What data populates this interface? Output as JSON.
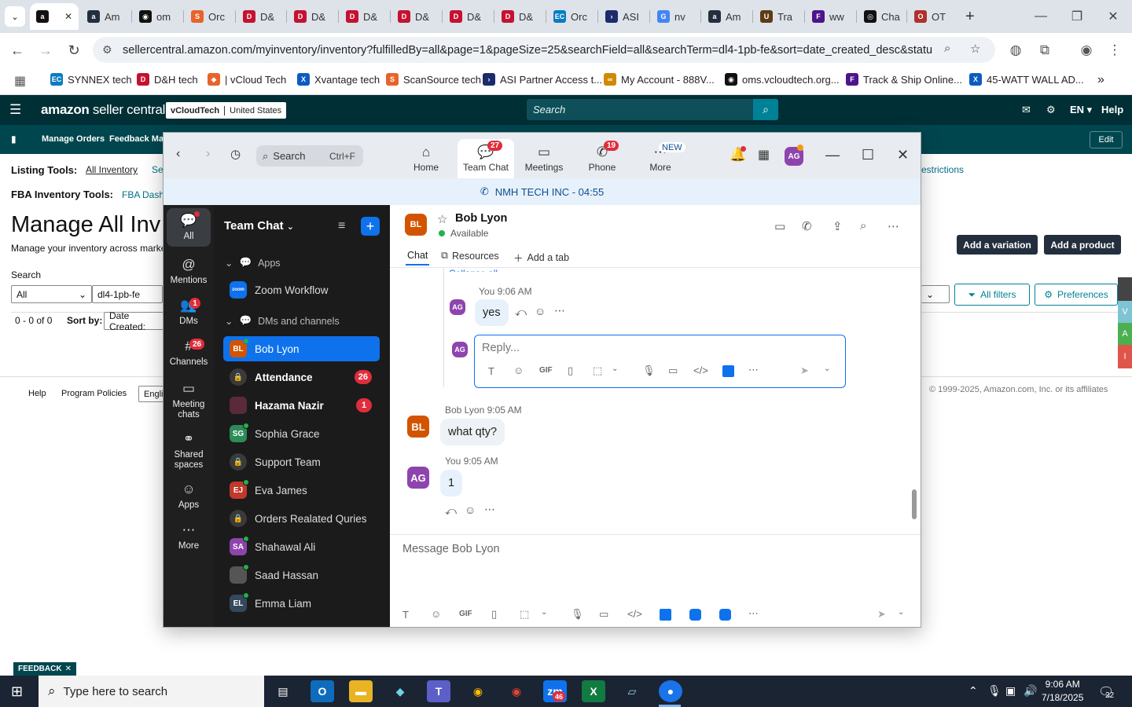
{
  "browser": {
    "tabs": [
      {
        "label": "",
        "fav": "a",
        "color": "#111111",
        "active": true
      },
      {
        "label": "Am",
        "fav": "a",
        "color": "#232f3e"
      },
      {
        "label": "om",
        "fav": "◉",
        "color": "#111111"
      },
      {
        "label": "Orc",
        "fav": "S",
        "color": "#e8632b"
      },
      {
        "label": "D&",
        "fav": "D",
        "color": "#c41230"
      },
      {
        "label": "D&",
        "fav": "D",
        "color": "#c41230"
      },
      {
        "label": "D&",
        "fav": "D",
        "color": "#c41230"
      },
      {
        "label": "D&",
        "fav": "D",
        "color": "#c41230"
      },
      {
        "label": "D&",
        "fav": "D",
        "color": "#c41230"
      },
      {
        "label": "D&",
        "fav": "D",
        "color": "#c41230"
      },
      {
        "label": "Orc",
        "fav": "EC",
        "color": "#0a7cc2"
      },
      {
        "label": "ASI",
        "fav": "›",
        "color": "#1b2b6b"
      },
      {
        "label": "nv",
        "fav": "G",
        "color": "#4285f4"
      },
      {
        "label": "Am",
        "fav": "a",
        "color": "#232f3e"
      },
      {
        "label": "Tra",
        "fav": "U",
        "color": "#5e3b16"
      },
      {
        "label": "ww",
        "fav": "F",
        "color": "#4d148c"
      },
      {
        "label": "Cha",
        "fav": "◎",
        "color": "#111111"
      },
      {
        "label": "OT",
        "fav": "O",
        "color": "#b03030"
      }
    ],
    "new_tab": "+",
    "url": "sellercentral.amazon.com/myinventory/inventory?fulfilledBy=all&page=1&pageSize=25&searchField=all&searchTerm=dl4-1pb-fe&sort=date_created_desc&status=...",
    "bookmarks": [
      {
        "label": "SYNNEX tech",
        "fav": "EC",
        "color": "#0a7cc2"
      },
      {
        "label": "D&H tech",
        "fav": "D",
        "color": "#c41230"
      },
      {
        "label": "| vCloud Tech",
        "fav": "◆",
        "color": "#e8632b"
      },
      {
        "label": "Xvantage tech",
        "fav": "X",
        "color": "#0a5cc2"
      },
      {
        "label": "ScanSource tech",
        "fav": "S",
        "color": "#e8632b"
      },
      {
        "label": "ASI Partner Access t...",
        "fav": "›",
        "color": "#1b2b6b"
      },
      {
        "label": "My Account - 888V...",
        "fav": "∞",
        "color": "#d08a00"
      },
      {
        "label": "oms.vcloudtech.org...",
        "fav": "◉",
        "color": "#111111"
      },
      {
        "label": "Track & Ship Online...",
        "fav": "F",
        "color": "#4d148c"
      },
      {
        "label": "45-WATT WALL AD...",
        "fav": "X",
        "color": "#0a5cc2"
      }
    ],
    "more_bookmarks": "»"
  },
  "amazon": {
    "logo_main": "amazon",
    "logo_sub": " seller central",
    "store_name": "vCloudTech",
    "store_country": "United States",
    "search_placeholder": "Search",
    "lang": "EN",
    "help": "Help",
    "nav": [
      "Manage Orders",
      "Feedback Man"
    ],
    "edit": "Edit",
    "listing_tools_label": "Listing Tools:",
    "listing_tools_link": "All Inventory",
    "listing_tools_more": "Se",
    "restrictions": "estrictions",
    "fba_tools_label": "FBA Inventory Tools:",
    "fba_tools_link": "FBA Dashb",
    "page_title": "Manage All Inv",
    "page_subtitle": "Manage your inventory across market",
    "add_variation": "Add a variation",
    "add_product": "Add a product",
    "search_label": "Search",
    "search_scope": "All",
    "search_value": "dl4-1pb-fe",
    "all_filters": "All filters",
    "preferences": "Preferences",
    "results": "0 - 0 of 0",
    "sort_label": "Sort by:",
    "sort_value": "Date Created:",
    "footer_help": "Help",
    "footer_policies": "Program Policies",
    "footer_lang": "Engli",
    "copyright": "© 1999-2025, Amazon.com, Inc. or its affiliates",
    "feedback": "FEEDBACK",
    "side_tabs": [
      "V",
      "A",
      "I"
    ]
  },
  "zoom": {
    "search_label": "Search",
    "search_shortcut": "Ctrl+F",
    "tabs": [
      {
        "label": "Home",
        "icon": "⌂",
        "badge": ""
      },
      {
        "label": "Team Chat",
        "icon": "💬",
        "badge": "27"
      },
      {
        "label": "Meetings",
        "icon": "▭",
        "badge": ""
      },
      {
        "label": "Phone",
        "icon": "✆",
        "badge": "19"
      },
      {
        "label": "More",
        "icon": "⋯",
        "badge": "NEW"
      }
    ],
    "avatar_initials": "AG",
    "banner": "NMH TECH INC - 04:55",
    "rail": [
      {
        "label": "All",
        "icon": "💬",
        "badge": ""
      },
      {
        "label": "Mentions",
        "icon": "@",
        "badge": ""
      },
      {
        "label": "DMs",
        "icon": "👥",
        "badge": "1"
      },
      {
        "label": "Channels",
        "icon": "#",
        "badge": "26"
      },
      {
        "label": "Meeting chats",
        "icon": "▭",
        "badge": ""
      },
      {
        "label": "Shared spaces",
        "icon": "⚭",
        "badge": ""
      },
      {
        "label": "Apps",
        "icon": "☺",
        "badge": ""
      },
      {
        "label": "More",
        "icon": "⋯",
        "badge": ""
      }
    ],
    "list_title": "Team Chat",
    "section_apps": "Apps",
    "app_item": "Zoom Workflow",
    "app_item_icon": "zoom",
    "section_dms": "DMs and channels",
    "items": [
      {
        "name": "Bob Lyon",
        "initials": "BL",
        "color": "#d35400",
        "count": "",
        "selected": true,
        "bold": false,
        "status": true
      },
      {
        "name": "Attendance",
        "initials": "🔒",
        "color": "#3a3a3a",
        "count": "26",
        "selected": false,
        "bold": true,
        "status": false
      },
      {
        "name": "Hazama Nazir",
        "initials": "",
        "color": "#5a2a3a",
        "count": "1",
        "selected": false,
        "bold": true,
        "status": false
      },
      {
        "name": "Sophia Grace",
        "initials": "SG",
        "color": "#2e8b57",
        "count": "",
        "selected": false,
        "bold": false,
        "status": true
      },
      {
        "name": "Support Team",
        "initials": "🔒",
        "color": "#3a3a3a",
        "count": "",
        "selected": false,
        "bold": false,
        "status": false
      },
      {
        "name": "Eva James",
        "initials": "EJ",
        "color": "#c0392b",
        "count": "",
        "selected": false,
        "bold": false,
        "status": true
      },
      {
        "name": "Orders Realated Quries",
        "initials": "🔒",
        "color": "#3a3a3a",
        "count": "",
        "selected": false,
        "bold": false,
        "status": false
      },
      {
        "name": "Shahawal Ali",
        "initials": "SA",
        "color": "#8e44ad",
        "count": "",
        "selected": false,
        "bold": false,
        "status": true
      },
      {
        "name": "Saad Hassan",
        "initials": "",
        "color": "#555555",
        "count": "",
        "selected": false,
        "bold": false,
        "status": true
      },
      {
        "name": "Emma Liam",
        "initials": "EL",
        "color": "#34495e",
        "count": "",
        "selected": false,
        "bold": false,
        "status": true
      }
    ],
    "chat": {
      "contact_name": "Bob Lyon",
      "contact_initials": "BL",
      "contact_status": "Available",
      "tab_chat": "Chat",
      "tab_resources": "Resources",
      "tab_add": "Add a tab",
      "collapse": "Collapse all",
      "messages": [
        {
          "sender": "You",
          "time": "9:06 AM",
          "text": "yes",
          "initials": "AG"
        },
        {
          "sender": "Bob Lyon",
          "time": "9:05 AM",
          "text": "what qty?",
          "initials": "BL"
        },
        {
          "sender": "You",
          "time": "9:05 AM",
          "text": "1",
          "initials": "AG"
        }
      ],
      "reply_placeholder": "Reply...",
      "compose_placeholder": "Message Bob Lyon",
      "gif": "GIF"
    }
  },
  "taskbar": {
    "search_placeholder": "Type here to search",
    "time": "9:06 AM",
    "date": "7/18/2025",
    "notifications": "22",
    "zoom_badge": "46"
  },
  "colors": {
    "zoom_blue": "#0e72ed",
    "amazon_teal": "#002f36",
    "badge_red": "#e02d3c"
  }
}
